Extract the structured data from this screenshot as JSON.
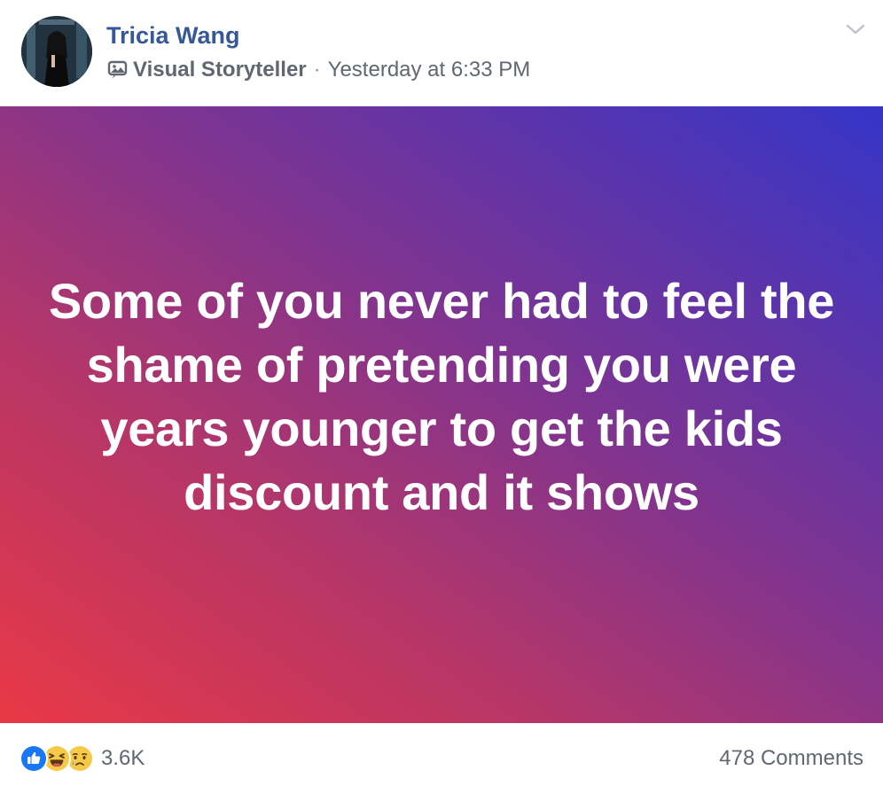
{
  "header": {
    "author_name": "Tricia Wang",
    "group_badge_icon": "visual-storyteller-icon",
    "group_name": "Visual Storyteller",
    "separator": "·",
    "timestamp": "Yesterday at 6:33 PM",
    "menu_icon": "chevron-down-icon"
  },
  "card": {
    "text": "Some of you never had to feel the shame of pretending you were years younger to get the kids discount and it shows",
    "gradient_colors": [
      "#e93845",
      "#b83666",
      "#7f3490",
      "#3535c8"
    ],
    "text_color": "#ffffff"
  },
  "footer": {
    "reactions": [
      {
        "type": "like",
        "icon": "like-icon",
        "color": "#1877f2"
      },
      {
        "type": "haha",
        "icon": "haha-icon",
        "color": "#f7c948"
      },
      {
        "type": "sad",
        "icon": "sad-icon",
        "color": "#f7c948"
      }
    ],
    "reaction_count": "3.6K",
    "comments_count": "478 Comments"
  },
  "colors": {
    "name_link": "#365899",
    "meta_text": "#616770"
  }
}
